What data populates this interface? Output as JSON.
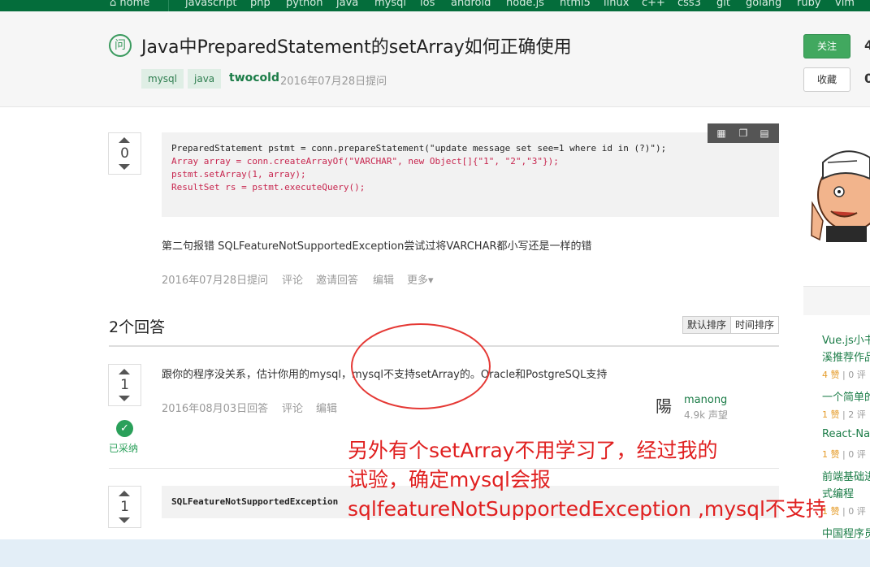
{
  "nav": {
    "items": [
      "home",
      "javascript",
      "php",
      "python",
      "java",
      "mysql",
      "ios",
      "android",
      "node.js",
      "html5",
      "linux",
      "c++",
      "css3",
      "git",
      "golang",
      "ruby",
      "vim"
    ]
  },
  "question": {
    "badge": "问",
    "title": "Java中PreparedStatement的setArray如何正确使用",
    "tags": [
      "mysql",
      "java"
    ],
    "author": "twocold",
    "asked": "2016年07月28日提问",
    "follow_label": "关注",
    "fav_label": "收藏",
    "votes": "0",
    "code": [
      "PreparedStatement pstmt = conn.prepareStatement(\"update message set see=1 where id in (?)\");",
      "Array array = conn.createArrayOf(\"VARCHAR\", new Object[]{\"1\", \"2\",\"3\"});",
      "pstmt.setArray(1, array);",
      "ResultSet rs = pstmt.executeQuery();"
    ],
    "body": "第二句报错 SQLFeatureNotSupportedException尝试过将VARCHAR都小写还是一样的错",
    "meta": {
      "date": "2016年07月28日提问",
      "comment": "评论",
      "invite": "邀请回答",
      "edit": "编辑",
      "more": "更多▾"
    }
  },
  "answers": {
    "title": "2个回答",
    "sort_default": "默认排序",
    "sort_time": "时间排序",
    "list": [
      {
        "votes": "1",
        "text": "跟你的程序没关系，估计你用的mysql，mysql不支持setArray的。Oracle和PostgreSQL支持",
        "date": "2016年08月03日回答",
        "comment": "评论",
        "edit": "编辑",
        "accepted_label": "已采纳",
        "user": "manong",
        "rep": "4.9k 声望",
        "avatar_glyph": "陽"
      },
      {
        "votes": "1",
        "code": "SQLFeatureNotSupportedException"
      }
    ]
  },
  "annotation": {
    "line1": "另外有个setArray不用学习了，经过我的",
    "line2": "试验，确定mysql会报",
    "line3": "sqlfeatureNotSupportedException ,mysql不支持"
  },
  "sidebar": {
    "links": [
      {
        "title": "Vue.js小书",
        "title2": "溪推荐作品",
        "votes": "4 赞",
        "comments": "0 评"
      },
      {
        "title": "一个简单的",
        "votes": "1 赞",
        "comments": "2 评"
      },
      {
        "title": "React-Na",
        "votes": "1 赞",
        "comments": "0 评"
      },
      {
        "title": "前端基础进",
        "title2": "式编程",
        "votes": "1 赞",
        "comments": "0 评"
      },
      {
        "title": "中国程序员"
      }
    ]
  },
  "colors": {
    "nav": "#046d3b",
    "accent": "#41a85f",
    "annotation": "#e02020"
  }
}
